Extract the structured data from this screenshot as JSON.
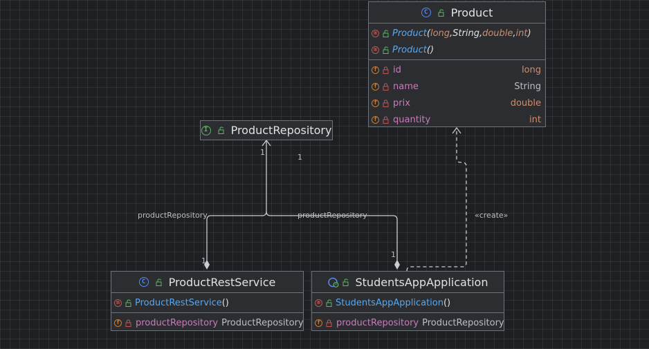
{
  "nodes": {
    "product": {
      "title": "Product",
      "constructors": [
        {
          "name": "Product",
          "open": "(",
          "close": ")",
          "params": [
            {
              "type": "long",
              "sep": ", "
            },
            {
              "type": "String",
              "sep": ", "
            },
            {
              "type": "double",
              "sep": ", "
            },
            {
              "type": "int",
              "sep": ""
            }
          ]
        },
        {
          "name": "Product",
          "call": "()"
        }
      ],
      "fields": [
        {
          "name": "id",
          "type": "long"
        },
        {
          "name": "name",
          "type": "String"
        },
        {
          "name": "prix",
          "type": "double"
        },
        {
          "name": "quantity",
          "type": "int"
        }
      ]
    },
    "product_repository": {
      "title": "ProductRepository"
    },
    "product_rest_service": {
      "title": "ProductRestService",
      "constructor": {
        "name": "ProductRestService",
        "call": "()"
      },
      "field": {
        "name": "productRepository",
        "type": "ProductRepository"
      }
    },
    "students_app": {
      "title": "StudentsAppApplication",
      "constructor": {
        "name": "StudentsAppApplication",
        "call": "()"
      },
      "field": {
        "name": "productRepository",
        "type": "ProductRepository"
      }
    }
  },
  "edges": {
    "rest_service_to_repo": {
      "label": "productRepository",
      "source_mult": "1",
      "target_mult": "1"
    },
    "app_to_repo": {
      "label": "productRepository",
      "source_mult": "1",
      "target_mult": "1"
    },
    "app_to_product": {
      "label": "«create»"
    }
  },
  "icons": {
    "class_badge": "C",
    "interface_badge": "I",
    "method_badge": "m",
    "field_badge": "f"
  },
  "colors": {
    "background": "#1e1f22",
    "node_fill": "#2b2d30",
    "node_border": "#6f737a",
    "constructor": "#56a8f5",
    "field_name": "#c77dbb",
    "param_type": "#cf8e6d",
    "class_icon": "#548af7",
    "interface_icon": "#5fb865",
    "method_icon": "#c75450",
    "field_icon": "#c77c3b"
  }
}
